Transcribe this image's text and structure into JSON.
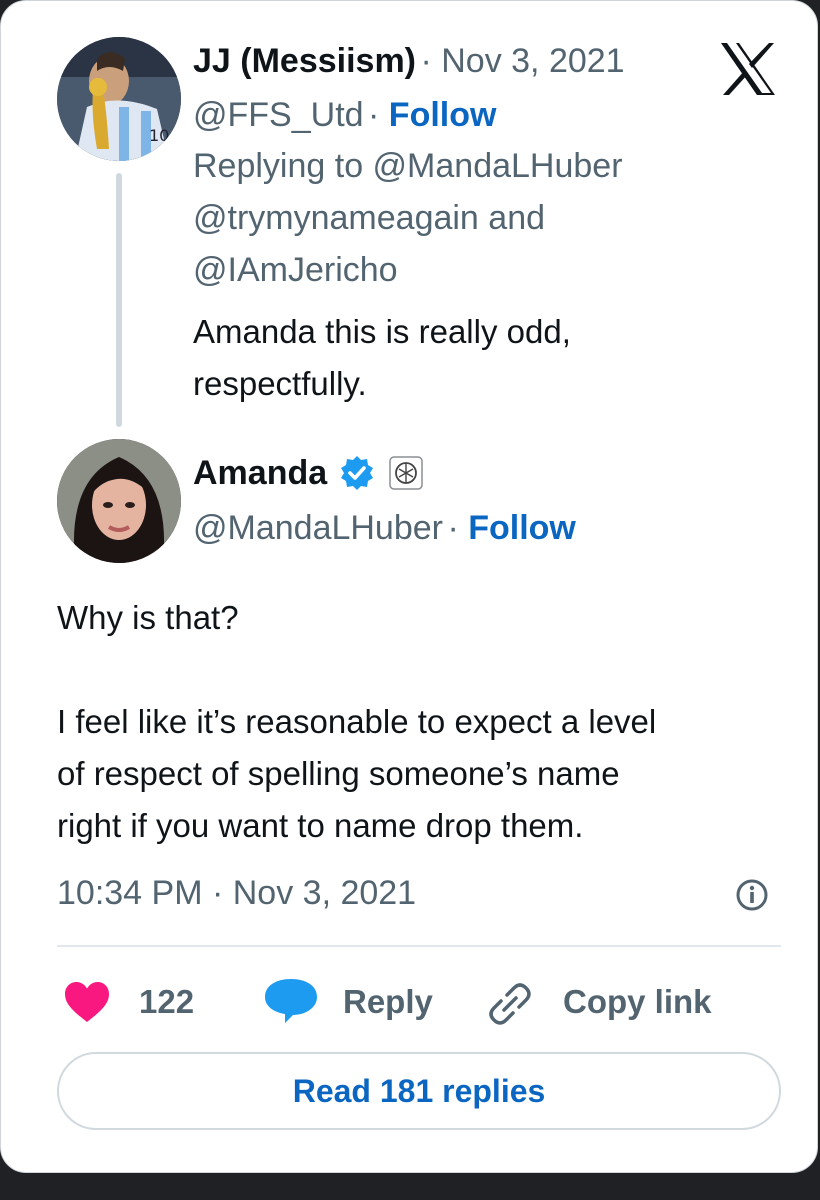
{
  "reply_tweet": {
    "author_name": "JJ (Messiism)",
    "date": "Nov 3, 2021",
    "handle": "@FFS_Utd",
    "follow_label": "Follow",
    "replying_to_line1": "Replying to @MandaLHuber",
    "replying_to_line2": "@trymynameagain and",
    "replying_to_line3": "@IAmJericho",
    "text_line1": "Amanda this is really odd,",
    "text_line2": "respectfully."
  },
  "main_tweet": {
    "author_name": "Amanda",
    "handle": "@MandaLHuber",
    "follow_label": "Follow",
    "text_line1": "Why is that?",
    "text_line2": "I feel like it’s reasonable to expect a level",
    "text_line3": "of respect of spelling someone’s name",
    "text_line4": "right if you want to name drop them.",
    "timestamp": "10:34 PM · Nov 3, 2021"
  },
  "actions": {
    "like_count": "122",
    "reply_label": "Reply",
    "copy_link_label": "Copy link"
  },
  "read_replies_label": "Read 181 replies",
  "icons": {
    "close": "x-logo-icon",
    "verified": "verified-badge-icon",
    "affiliate": "affiliate-badge-icon",
    "info": "info-icon",
    "like": "heart-icon",
    "reply": "speech-bubble-icon",
    "link": "link-icon"
  },
  "colors": {
    "accent": "#0b66c2",
    "verified": "#1d9bf0",
    "like": "#f91880",
    "text": "#0f1419",
    "secondary": "#536471"
  }
}
